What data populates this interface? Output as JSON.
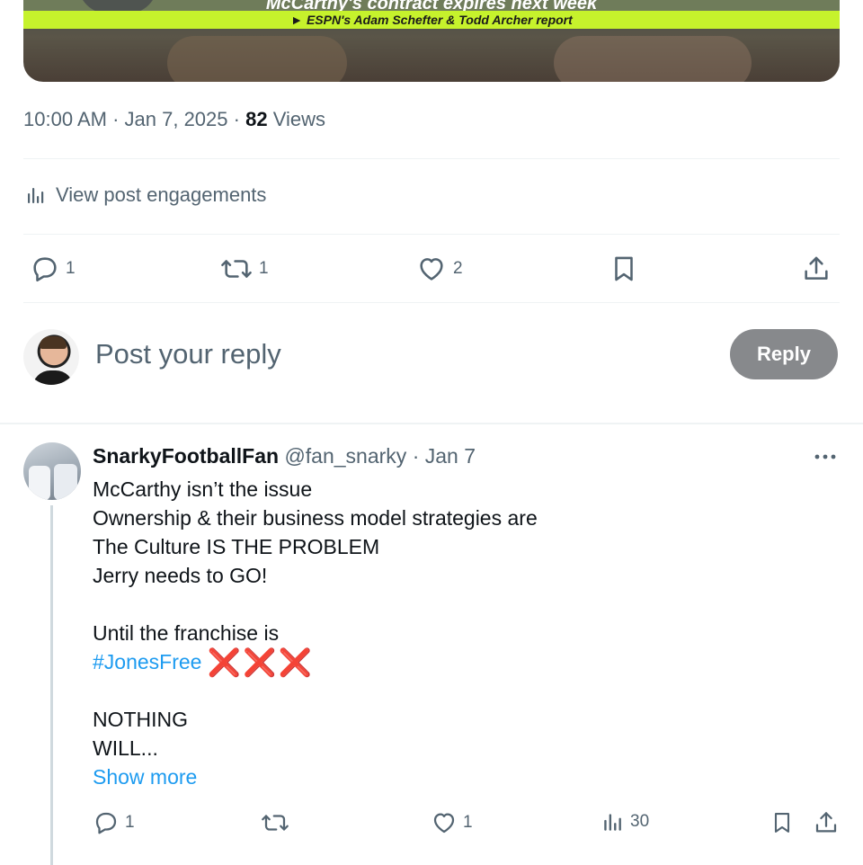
{
  "media": {
    "headline": "McCarthy's contract expires next week",
    "source": "► ESPN's Adam Schefter & Todd Archer report"
  },
  "post_meta": {
    "time": "10:00 AM",
    "sep1": "·",
    "date": "Jan 7, 2025",
    "sep2": "·",
    "views_count": "82",
    "views_label": "Views"
  },
  "engagements_link": "View post engagements",
  "main_actions": {
    "replies": "1",
    "reposts": "1",
    "likes": "2"
  },
  "composer": {
    "placeholder": "Post your reply",
    "reply_button": "Reply"
  },
  "reply_post": {
    "author_name": "SnarkyFootballFan",
    "handle": "@fan_snarky",
    "sep": "·",
    "date": "Jan 7",
    "lines": [
      "McCarthy isn’t the issue",
      "Ownership & their business model strategies are",
      "The Culture IS THE PROBLEM",
      "Jerry needs to GO!",
      "",
      "Until the franchise is"
    ],
    "hashtag": "#JonesFree",
    "emoji": "❌❌❌",
    "lines_after": [
      "",
      "NOTHING",
      "WILL..."
    ],
    "show_more": "Show more",
    "actions": {
      "replies": "1",
      "likes": "1",
      "views": "30"
    }
  }
}
